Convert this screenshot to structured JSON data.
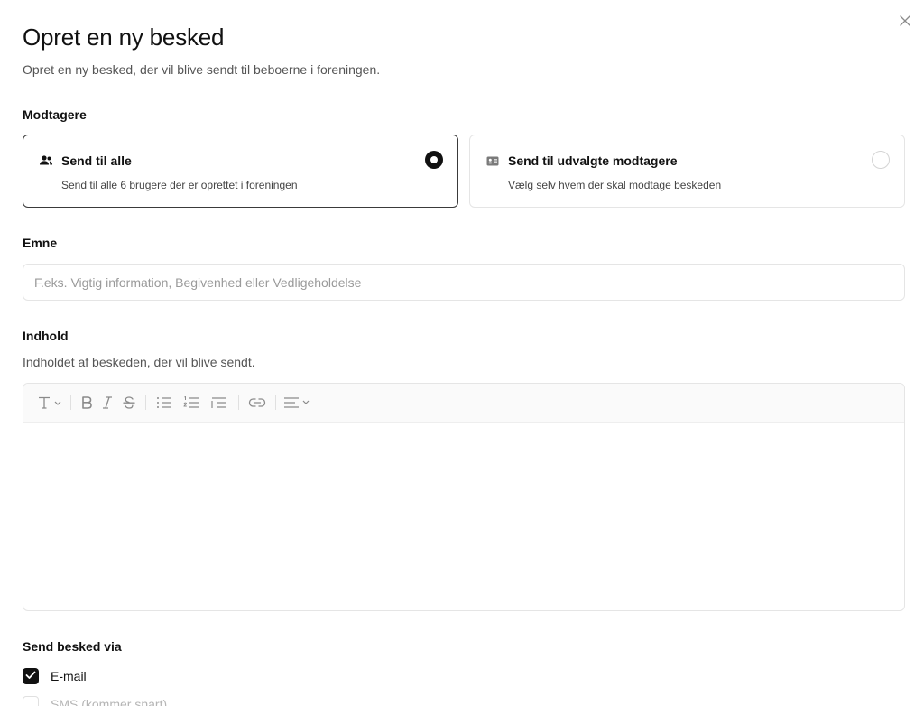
{
  "dialog": {
    "title": "Opret en ny besked",
    "subtitle": "Opret en ny besked, der vil blive sendt til beboerne i foreningen.",
    "close_icon": "close-icon"
  },
  "recipients": {
    "label": "Modtagere",
    "options": [
      {
        "title": "Send til alle",
        "description": "Send til alle 6 brugere der er oprettet i foreningen",
        "icon": "users-icon",
        "selected": true
      },
      {
        "title": "Send til udvalgte modtagere",
        "description": "Vælg selv hvem der skal modtage beskeden",
        "icon": "contact-card-icon",
        "selected": false
      }
    ]
  },
  "subject": {
    "label": "Emne",
    "value": "",
    "placeholder": "F.eks. Vigtig information, Begivenhed eller Vedligeholdelse"
  },
  "content": {
    "label": "Indhold",
    "description": "Indholdet af beskeden, der vil blive sendt.",
    "toolbar": [
      "text-type-dropdown",
      "bold",
      "italic",
      "strikethrough",
      "bullet-list",
      "numbered-list",
      "indent",
      "link",
      "align-dropdown"
    ],
    "value": ""
  },
  "send_via": {
    "label": "Send besked via",
    "options": [
      {
        "label": "E-mail",
        "checked": true,
        "disabled": false
      },
      {
        "label": "SMS (kommer snart)",
        "checked": false,
        "disabled": true
      }
    ]
  },
  "colors": {
    "primary": "#111111",
    "border": "#e5e5e5",
    "muted_text": "#555555",
    "placeholder": "#9a9a9a",
    "toolbar_bg": "#fafafa"
  }
}
